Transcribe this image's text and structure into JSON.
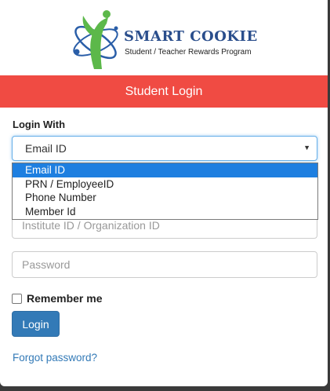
{
  "brand": {
    "title": "SMART COOKIE",
    "subtitle": "Student / Teacher Rewards Program"
  },
  "banner": {
    "title": "Student Login"
  },
  "form": {
    "login_with_label": "Login With",
    "select": {
      "value": "Email ID",
      "caret": "▼",
      "options": [
        "Email ID",
        "PRN / EmployeeID",
        "Phone Number",
        "Member Id"
      ]
    },
    "institute_placeholder": "Institute ID / Organization ID",
    "password_placeholder": "Password",
    "remember_label": "Remember me",
    "login_label": "Login",
    "forgot_label": "Forgot password?"
  },
  "colors": {
    "banner": "#f04b43",
    "brand_text": "#2a4e8c",
    "button": "#337ab7",
    "selected_option": "#1e7fe0",
    "logo_green": "#5cb84a",
    "logo_blue": "#2a5ea8"
  }
}
